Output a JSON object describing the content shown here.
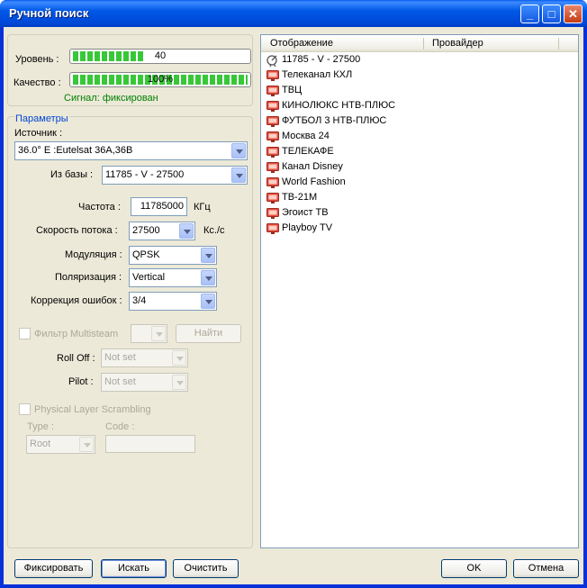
{
  "window": {
    "title": "Ручной поиск"
  },
  "signal": {
    "level_label": "Уровень :",
    "level_value": "40",
    "level_fraction": 0.4,
    "quality_label": "Качество :",
    "quality_value": "100%",
    "quality_fraction": 1.0,
    "status": "Сигнал: фиксирован"
  },
  "params": {
    "group_title": "Параметры",
    "source_label": "Источник :",
    "source_value": "36.0° E :Eutelsat 36A,36B",
    "from_db_label": "Из базы :",
    "from_db_value": "11785 - V - 27500",
    "freq_label": "Частота :",
    "freq_value": "11785000",
    "freq_unit": "КГц",
    "rate_label": "Скорость потока :",
    "rate_value": "27500",
    "rate_unit": "Кс./с",
    "mod_label": "Модуляция :",
    "mod_value": "QPSK",
    "pol_label": "Поляризация :",
    "pol_value": "Vertical",
    "fec_label": "Коррекция ошибок :",
    "fec_value": "3/4",
    "multistream_label": "Фильтр Multisteam",
    "find_label": "Найти",
    "rolloff_label": "Roll Off :",
    "rolloff_value": "Not set",
    "pilot_label": "Pilot :",
    "pilot_value": "Not set",
    "pls_label": "Physical Layer Scrambling",
    "type_label": "Type :",
    "type_value": "Root",
    "code_label": "Code :"
  },
  "list": {
    "columns": [
      "Отображение",
      "Провайдер"
    ],
    "items": [
      {
        "name": "11785 - V - 27500",
        "icon": "satellite-icon"
      },
      {
        "name": "Телеканал КХЛ",
        "icon": "tv-icon"
      },
      {
        "name": "ТВЦ",
        "icon": "tv-icon"
      },
      {
        "name": "КИНОЛЮКС НТВ-ПЛЮС",
        "icon": "tv-icon"
      },
      {
        "name": "ФУТБОЛ 3 НТВ-ПЛЮС",
        "icon": "tv-icon"
      },
      {
        "name": "Москва 24",
        "icon": "tv-icon"
      },
      {
        "name": "ТЕЛЕКАФЕ",
        "icon": "tv-icon"
      },
      {
        "name": "Канал Disney",
        "icon": "tv-icon"
      },
      {
        "name": "World Fashion",
        "icon": "tv-icon"
      },
      {
        "name": "ТВ-21М",
        "icon": "tv-icon"
      },
      {
        "name": "Эгоист ТВ",
        "icon": "tv-icon"
      },
      {
        "name": "Playboy TV",
        "icon": "tv-icon"
      }
    ]
  },
  "buttons": {
    "fix": "Фиксировать",
    "search": "Искать",
    "clear": "Очистить",
    "ok": "OK",
    "cancel": "Отмена"
  }
}
